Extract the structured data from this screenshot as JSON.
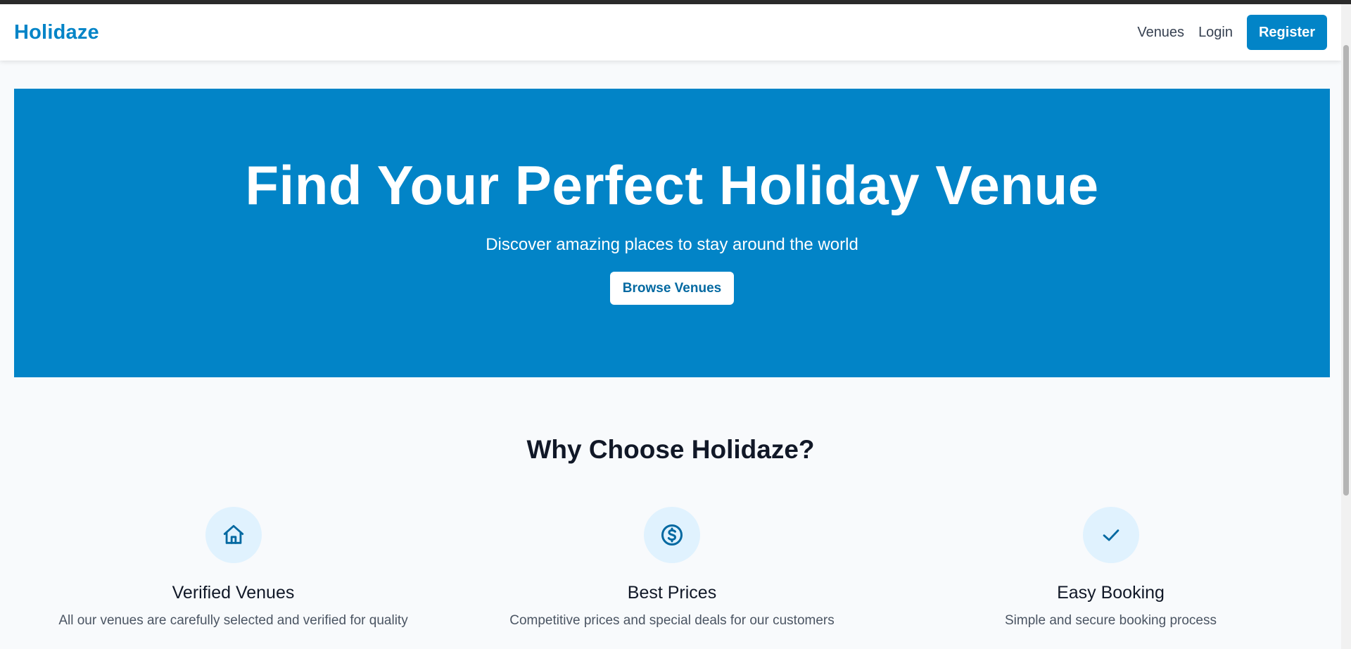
{
  "brand": "Holidaze",
  "nav": {
    "venues": "Venues",
    "login": "Login",
    "register": "Register"
  },
  "hero": {
    "title": "Find Your Perfect Holiday Venue",
    "subtitle": "Discover amazing places to stay around the world",
    "button": "Browse Venues"
  },
  "why": {
    "title": "Why Choose Holidaze?",
    "features": [
      {
        "icon": "home-icon",
        "title": "Verified Venues",
        "desc": "All our venues are carefully selected and verified for quality"
      },
      {
        "icon": "dollar-icon",
        "title": "Best Prices",
        "desc": "Competitive prices and special deals for our customers"
      },
      {
        "icon": "check-icon",
        "title": "Easy Booking",
        "desc": "Simple and secure booking process"
      }
    ]
  },
  "colors": {
    "primary": "#0284c7",
    "icon_bg": "#e0f2fe",
    "page_bg": "#f8fafc"
  }
}
